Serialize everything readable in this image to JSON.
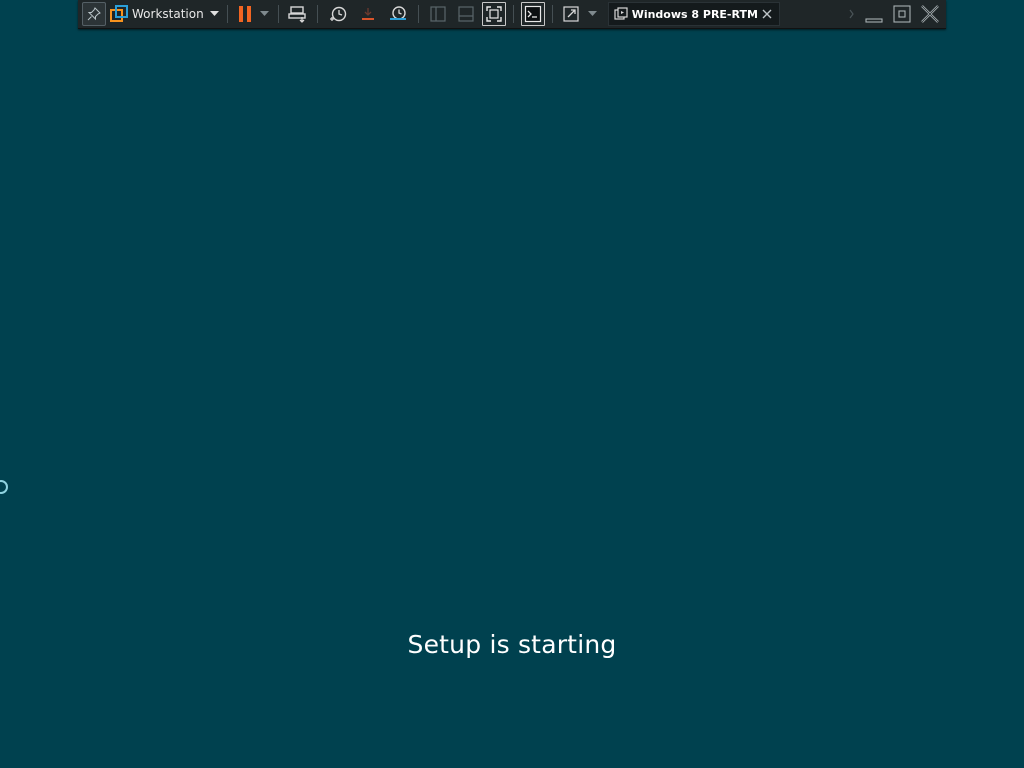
{
  "toolbar": {
    "library_menu_label": "Workstation",
    "vm_tab_title": "Windows 8 PRE-RTM ...",
    "icons": [
      "pin-icon",
      "vmware-logo-icon",
      "chevron-down-icon",
      "pause-icon",
      "send-ctrl-alt-del-icon",
      "snapshot-take-icon",
      "snapshot-revert-icon",
      "snapshot-manager-icon",
      "show-library-icon",
      "thumbnail-bar-icon",
      "full-screen-icon",
      "console-icon",
      "stretch-guest-icon",
      "vm-icon",
      "close-icon",
      "minimize-icon",
      "restore-icon"
    ],
    "colors": {
      "pause": "#f26522",
      "snapshot_revert": "#d9542b",
      "toolbar_bg": "#1f2628"
    }
  },
  "guest": {
    "background_color": "#00414f",
    "status_text": "Setup is starting",
    "spinner": "loading-spinner-icon"
  }
}
